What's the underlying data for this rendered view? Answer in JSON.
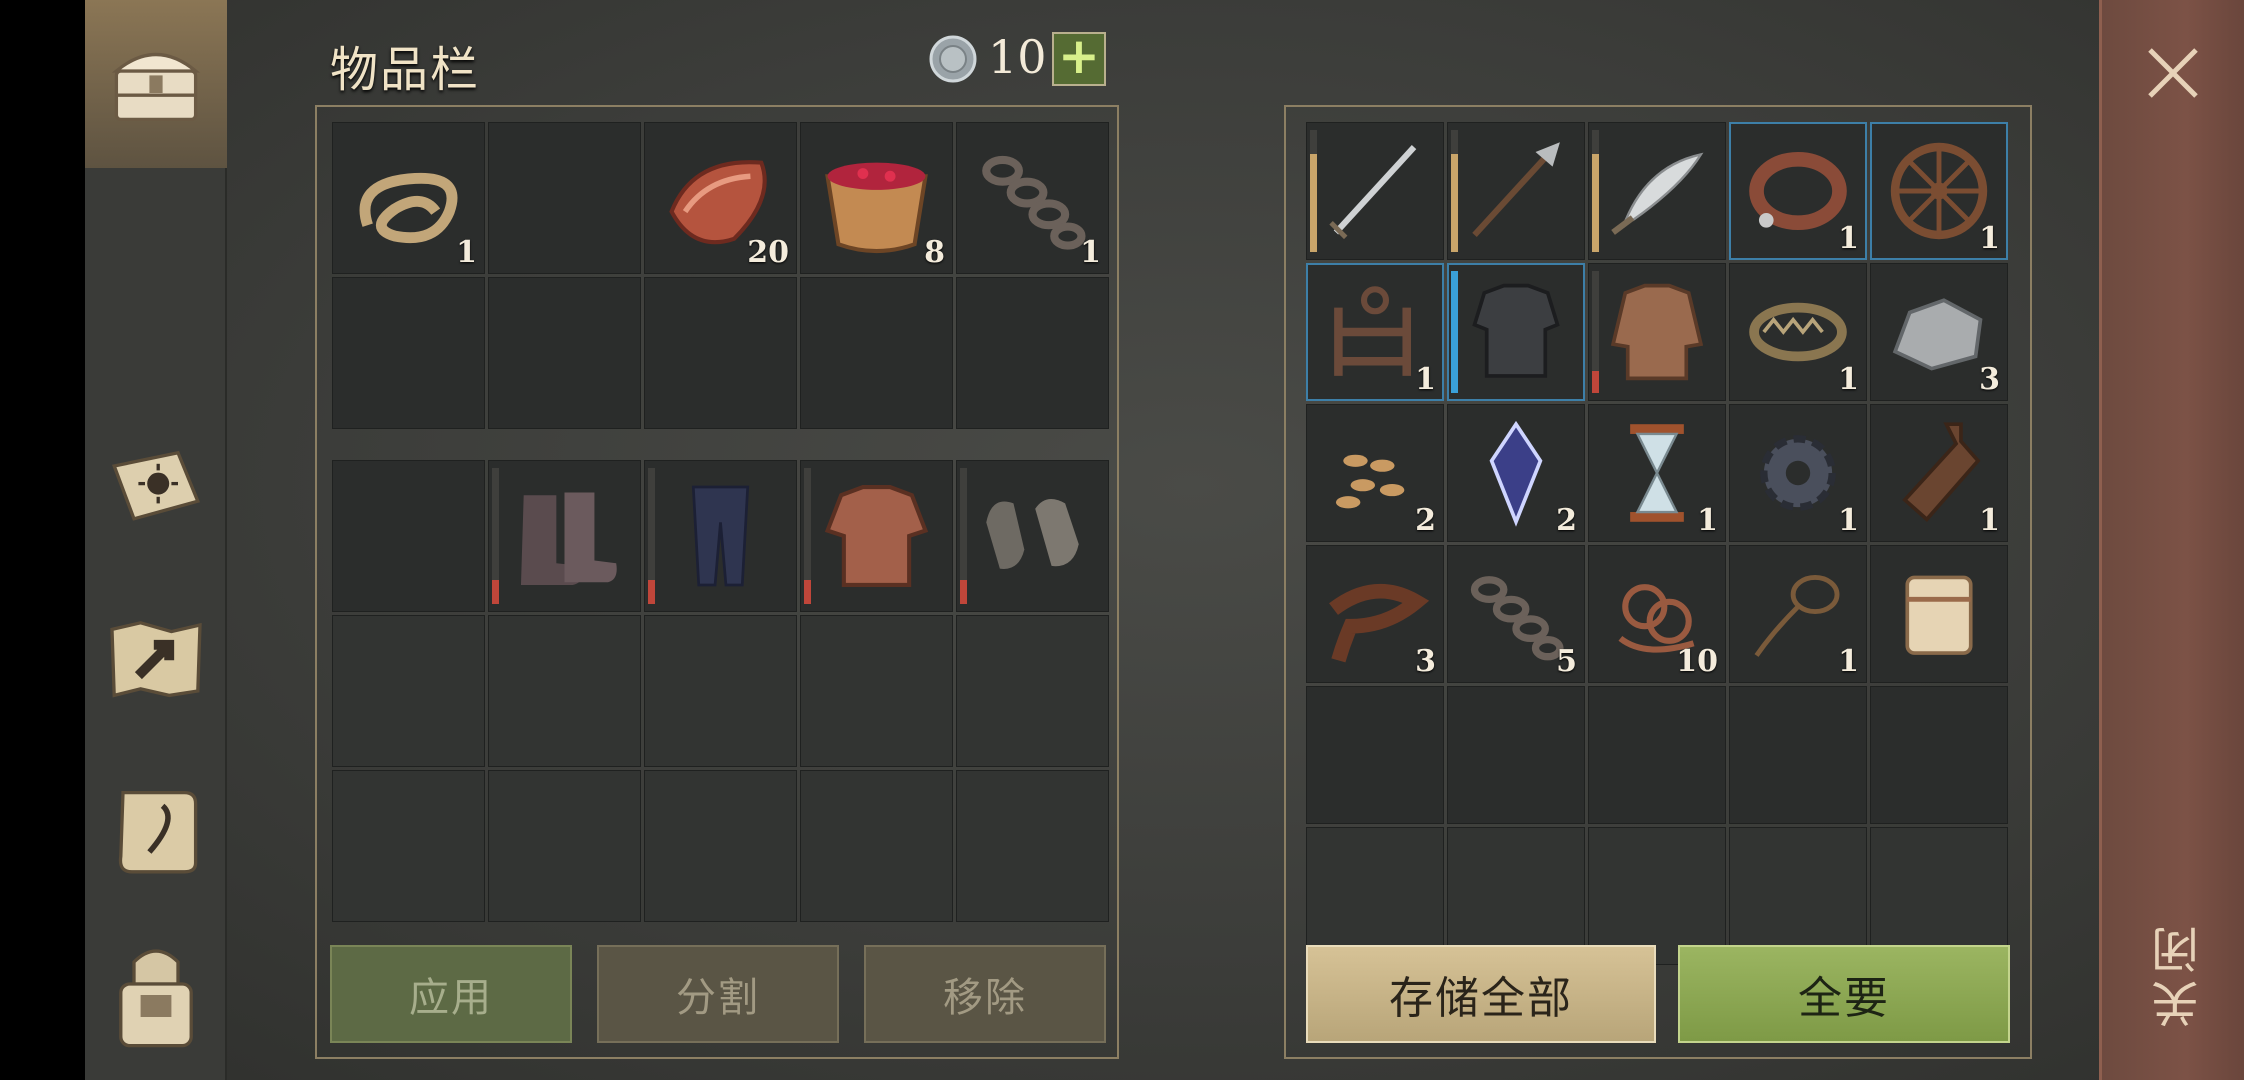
{
  "header": {
    "title": "物品栏",
    "coin_icon": "silver-coin-icon",
    "coin_count": "10",
    "add_label": "+"
  },
  "rail": [
    {
      "name": "chest-icon",
      "active": true
    },
    {
      "name": "crafting-book-icon"
    },
    {
      "name": "map-icon"
    },
    {
      "name": "scroll-quest-icon"
    },
    {
      "name": "character-icon"
    }
  ],
  "backpack": {
    "slots": [
      {
        "icon": "rope-icon",
        "qty": "1"
      },
      {
        "icon": "",
        "qty": ""
      },
      {
        "icon": "raw-meat-icon",
        "qty": "20"
      },
      {
        "icon": "berry-bowl-icon",
        "qty": "8"
      },
      {
        "icon": "chain-icon",
        "qty": "1"
      },
      {
        "icon": "",
        "qty": ""
      },
      {
        "icon": "",
        "qty": ""
      },
      {
        "icon": "",
        "qty": ""
      },
      {
        "icon": "",
        "qty": ""
      },
      {
        "icon": "",
        "qty": ""
      }
    ]
  },
  "equipment": {
    "slots": [
      {
        "icon": "",
        "qty": "",
        "bar": false
      },
      {
        "icon": "boots-icon",
        "qty": "",
        "bar": true
      },
      {
        "icon": "pants-icon",
        "qty": "",
        "bar": true
      },
      {
        "icon": "leather-armor-icon",
        "qty": "",
        "bar": true
      },
      {
        "icon": "gloves-icon",
        "qty": "",
        "bar": true
      }
    ],
    "extra_rows": 2
  },
  "actions": {
    "apply": "应用",
    "split": "分割",
    "remove": "移除"
  },
  "storage": {
    "slots": [
      {
        "icon": "sword-icon",
        "qty": "",
        "bar": "tan"
      },
      {
        "icon": "halberd-icon",
        "qty": "",
        "bar": "tan"
      },
      {
        "icon": "scimitar-icon",
        "qty": "",
        "bar": "tan"
      },
      {
        "icon": "leather-collar-icon",
        "qty": "1",
        "sel": true
      },
      {
        "icon": "wagon-wheel-icon",
        "qty": "1",
        "sel": true
      },
      {
        "icon": "ladder-frame-icon",
        "qty": "1",
        "sel": true
      },
      {
        "icon": "scale-armor-icon",
        "qty": "",
        "bar": "blue",
        "sel": true
      },
      {
        "icon": "chainmail-shirt-icon",
        "qty": "",
        "bar": "red"
      },
      {
        "icon": "bear-trap-icon",
        "qty": "1"
      },
      {
        "icon": "stone-ore-icon",
        "qty": "3"
      },
      {
        "icon": "seeds-icon",
        "qty": "2"
      },
      {
        "icon": "magic-crystal-icon",
        "qty": "2"
      },
      {
        "icon": "hourglass-icon",
        "qty": "1"
      },
      {
        "icon": "gear-icon",
        "qty": "1"
      },
      {
        "icon": "bottle-icon",
        "qty": "1"
      },
      {
        "icon": "leather-strip-icon",
        "qty": "3"
      },
      {
        "icon": "chain-icon",
        "qty": "5"
      },
      {
        "icon": "rope-bundle-icon",
        "qty": "10"
      },
      {
        "icon": "lasso-icon",
        "qty": "1"
      },
      {
        "icon": "scroll-icon",
        "qty": ""
      }
    ]
  },
  "storage_actions": {
    "store_all": "存储全部",
    "take_all": "全要"
  },
  "close": {
    "label": "关闭",
    "icon": "close-icon"
  }
}
